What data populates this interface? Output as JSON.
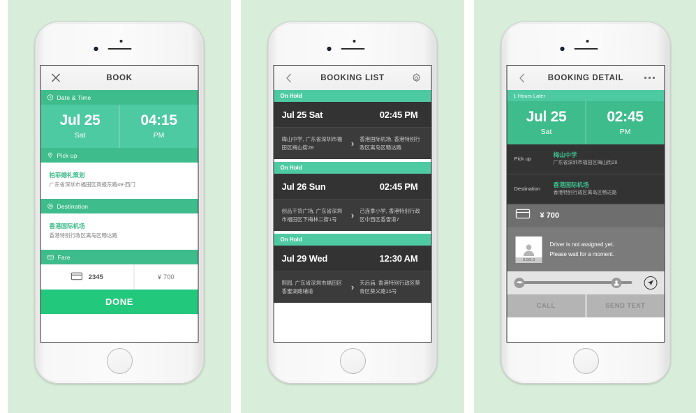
{
  "panels": [
    {
      "id": "book",
      "appbar": {
        "left_icon": "close-icon",
        "title": "BOOK"
      },
      "sections": {
        "datetime": {
          "label": "Date & Time",
          "icon": "clock-icon",
          "date": "Jul 25",
          "weekday": "Sat",
          "time": "04:15",
          "meridiem": "PM"
        },
        "pickup": {
          "label": "Pick up",
          "icon": "pin-icon",
          "name": "柏菲婚礼策划",
          "address": "广东省深圳市福田区商报东路49-西门"
        },
        "destination": {
          "label": "Destination",
          "icon": "pin-icon",
          "name": "香港国际机场",
          "address": "香港特别行政区离岛区畅达路"
        },
        "fare": {
          "label": "Fare",
          "icon": "card-icon",
          "card_last4": "2345",
          "amount": "¥ 700"
        }
      },
      "done_label": "DONE"
    },
    {
      "id": "booking-list",
      "appbar": {
        "left_icon": "back-chevron-icon",
        "title": "BOOKING LIST",
        "right_icon": "gear-icon"
      },
      "bookings": [
        {
          "status": "On Hold",
          "date": "Jul 25 Sat",
          "time": "02:45 PM",
          "origin": "梅山中学, 广东省深圳市福田区梅山街28",
          "destination": "香港国际机场, 香港特别行政区离岛区畅达路"
        },
        {
          "status": "On Hold",
          "date": "Jul 26 Sun",
          "time": "02:45 PM",
          "origin": "创品干货广场, 广东省深圳市福田区下梅林二街1号",
          "destination": "己连拿小学, 香港特别行政区中西区香雪道7"
        },
        {
          "status": "On Hold",
          "date": "Jul 29 Wed",
          "time": "12:30 AM",
          "origin": "熙园, 广东省深圳市福田区香蜜湖路辅道",
          "destination": "天后庙, 香港特别行政区葵青区葵义路15号"
        }
      ]
    },
    {
      "id": "booking-detail",
      "appbar": {
        "left_icon": "back-chevron-icon",
        "title": "BOOKING DETAIL",
        "right_icon": "more-icon"
      },
      "later_strip": "1 Hours Later",
      "datetime": {
        "date": "Jul 25",
        "weekday": "Sat",
        "time": "02:45",
        "meridiem": "PM"
      },
      "pickup": {
        "label": "Pick up",
        "name": "梅山中学",
        "address": "广东省深圳市福田区梅山街28"
      },
      "destination": {
        "label": "Destination",
        "name": "香港国际机场",
        "address": "香港特别行政区离岛区畅达路"
      },
      "payment": {
        "icon": "card-icon",
        "amount": "¥ 700"
      },
      "driver": {
        "rating": "0.0/5.0",
        "message_line1": "Driver is not assigned yet.",
        "message_line2": "Please wait for a moment."
      },
      "tracking": {
        "left_icon": "car-icon",
        "right_icon": "person-icon",
        "locate_icon": "navigation-arrow-icon"
      },
      "actions": {
        "call_label": "CALL",
        "text_label": "SEND TEXT"
      }
    }
  ],
  "colors": {
    "panel_bg": "#d9eeda",
    "green_header": "#3fbc8c",
    "green_light": "#4ecaa2",
    "green_done": "#22c87c",
    "card_dark": "#333333",
    "gray_mid": "#7b7b7b"
  }
}
